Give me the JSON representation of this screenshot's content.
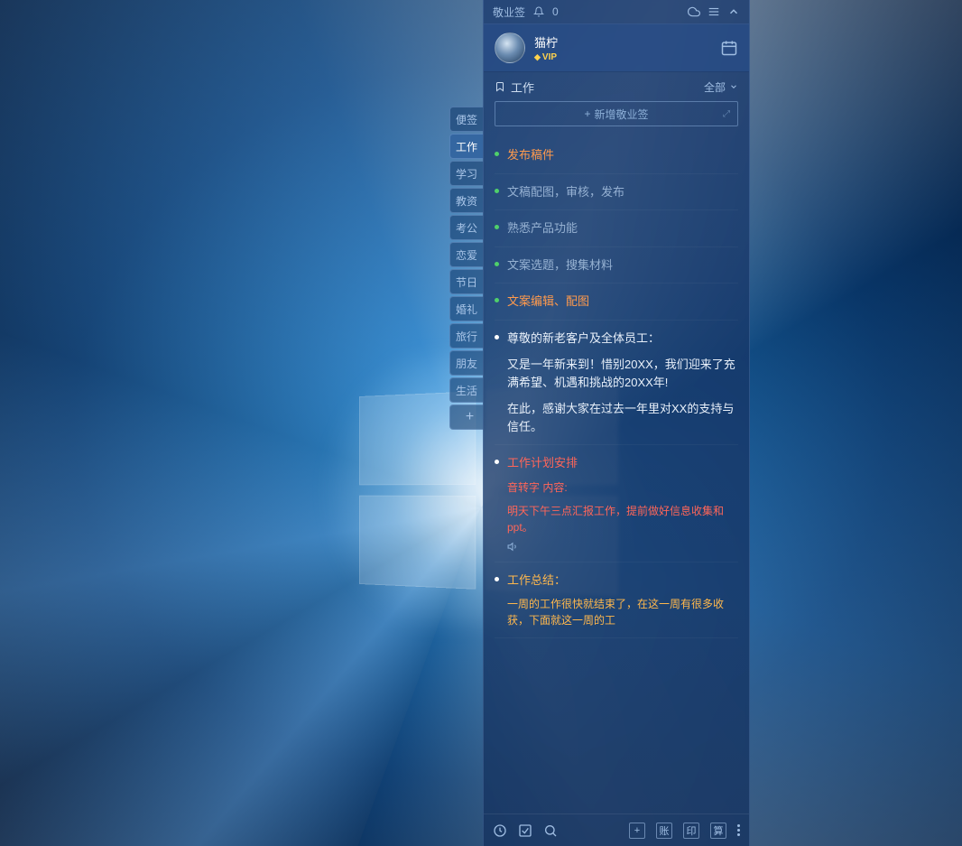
{
  "app": {
    "title": "敬业签",
    "notification_count": "0"
  },
  "user": {
    "name": "猫柠",
    "vip_label": "VIP"
  },
  "subheader": {
    "category": "工作",
    "filter": "全部"
  },
  "addnote": {
    "label": "新增敬业签"
  },
  "side_tabs": [
    {
      "label": "便签",
      "active": false
    },
    {
      "label": "工作",
      "active": true
    },
    {
      "label": "学习",
      "active": false
    },
    {
      "label": "教资",
      "active": false
    },
    {
      "label": "考公",
      "active": false
    },
    {
      "label": "恋爱",
      "active": false
    },
    {
      "label": "节日",
      "active": false
    },
    {
      "label": "婚礼",
      "active": false
    },
    {
      "label": "旅行",
      "active": false
    },
    {
      "label": "朋友",
      "active": false
    },
    {
      "label": "生活",
      "active": false
    }
  ],
  "notes": [
    {
      "dot": "green",
      "cls": "txt-orange",
      "lines": [
        "发布稿件"
      ]
    },
    {
      "dot": "green",
      "cls": "txt-faded",
      "lines": [
        "文稿配图，审核，发布"
      ]
    },
    {
      "dot": "green",
      "cls": "txt-faded",
      "lines": [
        "熟悉产品功能"
      ]
    },
    {
      "dot": "green",
      "cls": "txt-faded",
      "lines": [
        "文案选题，搜集材料"
      ]
    },
    {
      "dot": "green",
      "cls": "txt-orange",
      "lines": [
        "文案编辑、配图"
      ]
    },
    {
      "dot": "white",
      "cls": "txt-white",
      "lines": [
        "尊敬的新老客户及全体员工：",
        "又是一年新来到！惜别20XX，我们迎来了充满希望、机遇和挑战的20XX年!",
        "在此，感谢大家在过去一年里对XX的支持与信任。"
      ]
    },
    {
      "dot": "white",
      "cls": "txt-red",
      "lines": [
        "工作计划安排"
      ],
      "sub": {
        "cls": "txt-red",
        "lines": [
          "音转字 内容:",
          "明天下午三点汇报工作，提前做好信息收集和 ppt。"
        ]
      },
      "audio": true
    },
    {
      "dot": "white",
      "cls": "txt-yellow",
      "lines": [
        "工作总结："
      ],
      "sub": {
        "cls": "txt-yellow",
        "lines": [
          "一周的工作很快就结束了，在这一周有很多收获，下面就这一周的工"
        ]
      }
    }
  ],
  "bottom_buttons": {
    "b1": "账",
    "b2": "印",
    "b3": "算"
  }
}
